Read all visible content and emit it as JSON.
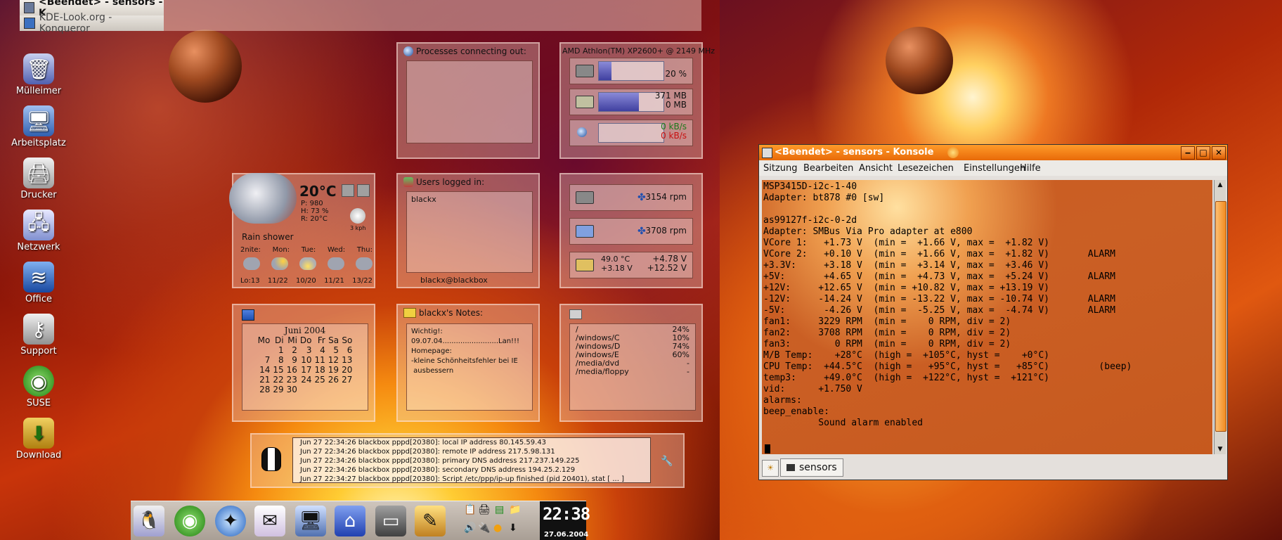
{
  "desktop": {
    "icons": [
      {
        "label": "Mülleimer",
        "icon": "trash-icon"
      },
      {
        "label": "Arbeitsplatz",
        "icon": "computer-icon"
      },
      {
        "label": "Drucker",
        "icon": "printer-icon"
      },
      {
        "label": "Netzwerk",
        "icon": "network-icon"
      },
      {
        "label": "Office",
        "icon": "office-icon"
      },
      {
        "label": "Support",
        "icon": "support-icon"
      },
      {
        "label": "SUSE",
        "icon": "suse-icon"
      },
      {
        "label": "Download",
        "icon": "download-icon"
      }
    ]
  },
  "konqueror_tasks": [
    "<Beendet> - sensors - K",
    "KDE-Look.org - Konqueror"
  ],
  "weather": {
    "temp": "20°C",
    "pressure": "P: 980",
    "humidity": "H: 73 %",
    "realfeel": "R: 20°C",
    "wind": "3 kph",
    "condition": "Rain shower",
    "days": [
      "2nite:",
      "Mon:",
      "Tue:",
      "Wed:",
      "Thu:"
    ],
    "ranges": [
      "Lo:13",
      "11/22",
      "10/20",
      "11/21",
      "13/22"
    ]
  },
  "calendar": {
    "month": "Juni 2004",
    "weekdays": [
      "Mo",
      "Di",
      "Mi",
      "Do",
      "Fr",
      "Sa",
      "So"
    ],
    "weeks": [
      [
        "",
        "1",
        "2",
        "3",
        "4",
        "5",
        "6"
      ],
      [
        "7",
        "8",
        "9",
        "10",
        "11",
        "12",
        "13"
      ],
      [
        "14",
        "15",
        "16",
        "17",
        "18",
        "19",
        "20"
      ],
      [
        "21",
        "22",
        "23",
        "24",
        "25",
        "26",
        "27"
      ],
      [
        "28",
        "29",
        "30",
        "",
        "",
        "",
        ""
      ]
    ]
  },
  "processes": {
    "title": "Processes connecting out:"
  },
  "users": {
    "title": "Users logged in:",
    "user": "blackx",
    "host": "blackx@blackbox"
  },
  "notes": {
    "title": "blackx's Notes:",
    "lines": [
      "Wichtig!:",
      "09.07.04.........................Lan!!!",
      "Homepage:",
      "-kleine Schönheitsfehler bei IE",
      " ausbessern"
    ]
  },
  "system": {
    "cpu_name": "AMD Athlon(TM) XP2600+ @ 2149 MHz",
    "cpu_load": "20 %",
    "cpu_load_value": 0.2,
    "mem_used": "371 MB",
    "swap_used": "0 MB",
    "mem_fill": 0.62,
    "net_in": "0 kB/s",
    "net_out": "0 kB/s",
    "fan1": "3154 rpm",
    "fan2": "3708 rpm",
    "temp1": "49.0 °C",
    "v33": "+3.18 V",
    "v5": "+4.78 V",
    "v12": "+12.52 V"
  },
  "disks": [
    {
      "mount": "/",
      "use": "24%"
    },
    {
      "mount": "/windows/C",
      "use": "10%"
    },
    {
      "mount": "/windows/D",
      "use": "74%"
    },
    {
      "mount": "/windows/E",
      "use": "60%"
    },
    {
      "mount": "/media/dvd",
      "use": "-"
    },
    {
      "mount": "/media/floppy",
      "use": "-"
    }
  ],
  "log": [
    "Jun 27 22:34:26 blackbox pppd[20380]: local  IP address 80.145.59.43",
    "Jun 27 22:34:26 blackbox pppd[20380]: remote IP address 217.5.98.131",
    "Jun 27 22:34:26 blackbox pppd[20380]: primary   DNS address 217.237.149.225",
    "Jun 27 22:34:26 blackbox pppd[20380]: secondary DNS address 194.25.2.129",
    "Jun 27 22:34:27 blackbox pppd[20380]: Script /etc/ppp/ip-up finished (pid 20401), stat  [ ... ]"
  ],
  "clock": {
    "time": "22:38",
    "date": "27.06.2004"
  },
  "konsole": {
    "title": "<Beendet> - sensors - Konsole",
    "menu": [
      "Sitzung",
      "Bearbeiten",
      "Ansicht",
      "Lesezeichen",
      "Einstellungen",
      "Hilfe"
    ],
    "tab": "sensors",
    "output": "MSP3415D-i2c-1-40\nAdapter: bt878 #0 [sw]\n\nas99127f-i2c-0-2d\nAdapter: SMBus Via Pro adapter at e800\nVCore 1:   +1.73 V  (min =  +1.66 V, max =  +1.82 V)\nVCore 2:   +0.10 V  (min =  +1.66 V, max =  +1.82 V)       ALARM\n+3.3V:     +3.18 V  (min =  +3.14 V, max =  +3.46 V)\n+5V:       +4.65 V  (min =  +4.73 V, max =  +5.24 V)       ALARM\n+12V:     +12.65 V  (min = +10.82 V, max = +13.19 V)\n-12V:     -14.24 V  (min = -13.22 V, max = -10.74 V)       ALARM\n-5V:       -4.26 V  (min =  -5.25 V, max =  -4.74 V)       ALARM\nfan1:     3229 RPM  (min =    0 RPM, div = 2)\nfan2:     3708 RPM  (min =    0 RPM, div = 2)\nfan3:        0 RPM  (min =    0 RPM, div = 2)\nM/B Temp:    +28°C  (high =  +105°C, hyst =    +0°C)\nCPU Temp:  +44.5°C  (high =   +95°C, hyst =   +85°C)         (beep)\ntemp3:     +49.0°C  (high =  +122°C, hyst =  +121°C)\nvid:      +1.750 V\nalarms:\nbeep_enable:\n          Sound alarm enabled"
  }
}
